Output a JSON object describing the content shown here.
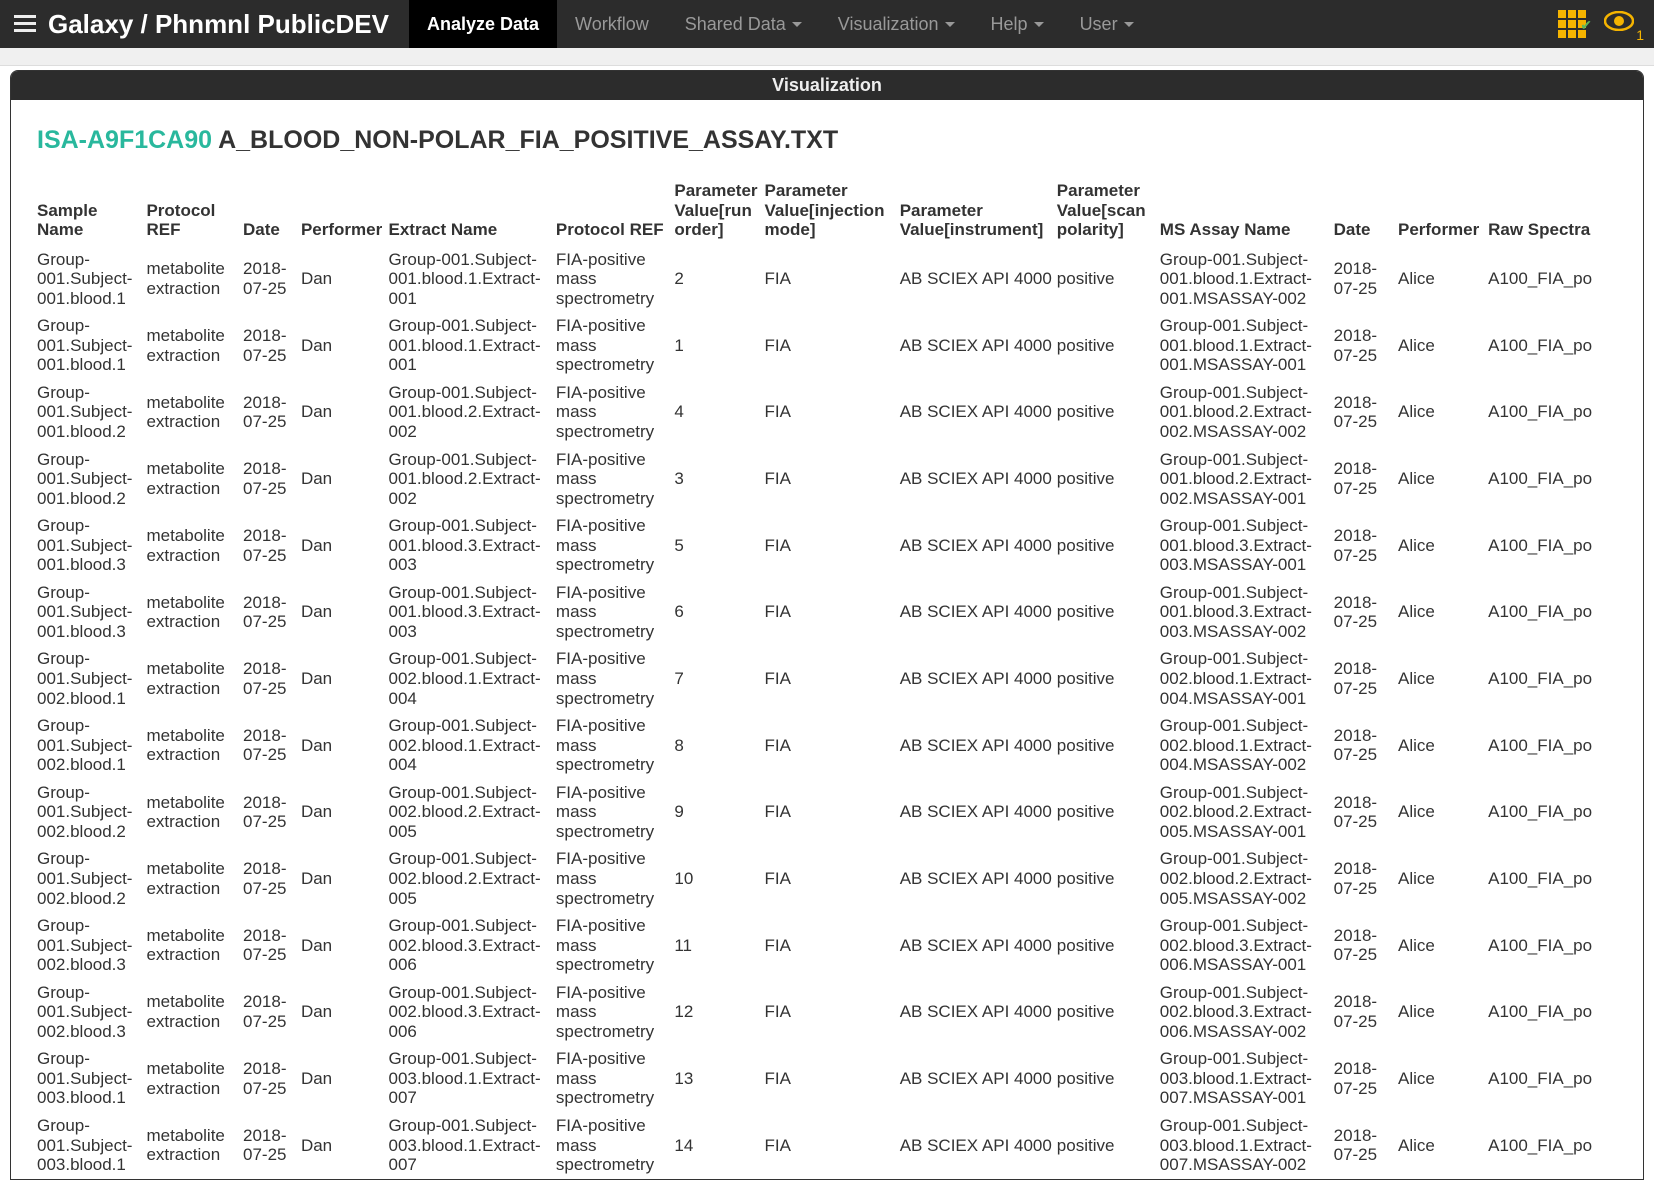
{
  "navbar": {
    "brand": "Galaxy / Phnmnl PublicDEV",
    "items": [
      {
        "label": "Analyze Data",
        "active": true,
        "dropdown": false
      },
      {
        "label": "Workflow",
        "active": false,
        "dropdown": false
      },
      {
        "label": "Shared Data",
        "active": false,
        "dropdown": true
      },
      {
        "label": "Visualization",
        "active": false,
        "dropdown": true
      },
      {
        "label": "Help",
        "active": false,
        "dropdown": true
      },
      {
        "label": "User",
        "active": false,
        "dropdown": true
      }
    ],
    "eye_badge": "1"
  },
  "panel": {
    "header": "Visualization",
    "isa_id": "ISA-A9F1CA90",
    "filename": "A_BLOOD_NON-POLAR_FIA_POSITIVE_ASSAY.TXT"
  },
  "table": {
    "headers": [
      "Sample Name",
      "Protocol REF",
      "Date",
      "Performer",
      "Extract Name",
      "Protocol REF",
      "Parameter Value[run order]",
      "Parameter Value[injection mode]",
      "Parameter Value[instrument]",
      "Parameter Value[scan polarity]",
      "MS Assay Name",
      "Date",
      "Performer",
      "Raw Spectra"
    ],
    "rows": [
      {
        "sample": "Group-001.Subject-001.blood.1",
        "proto1": "metabolite extraction",
        "date1": "2018-07-25",
        "perf1": "Dan",
        "extract": "Group-001.Subject-001.blood.1.Extract-001",
        "proto2": "FIA-positive mass spectrometry",
        "run": "2",
        "inj": "FIA",
        "instr": "AB SCIEX API 4000",
        "pol": "positive",
        "msassay": "Group-001.Subject-001.blood.1.Extract-001.MSASSAY-002",
        "date2": "2018-07-25",
        "perf2": "Alice",
        "raw": "A100_FIA_po"
      },
      {
        "sample": "Group-001.Subject-001.blood.1",
        "proto1": "metabolite extraction",
        "date1": "2018-07-25",
        "perf1": "Dan",
        "extract": "Group-001.Subject-001.blood.1.Extract-001",
        "proto2": "FIA-positive mass spectrometry",
        "run": "1",
        "inj": "FIA",
        "instr": "AB SCIEX API 4000",
        "pol": "positive",
        "msassay": "Group-001.Subject-001.blood.1.Extract-001.MSASSAY-001",
        "date2": "2018-07-25",
        "perf2": "Alice",
        "raw": "A100_FIA_po"
      },
      {
        "sample": "Group-001.Subject-001.blood.2",
        "proto1": "metabolite extraction",
        "date1": "2018-07-25",
        "perf1": "Dan",
        "extract": "Group-001.Subject-001.blood.2.Extract-002",
        "proto2": "FIA-positive mass spectrometry",
        "run": "4",
        "inj": "FIA",
        "instr": "AB SCIEX API 4000",
        "pol": "positive",
        "msassay": "Group-001.Subject-001.blood.2.Extract-002.MSASSAY-002",
        "date2": "2018-07-25",
        "perf2": "Alice",
        "raw": "A100_FIA_po"
      },
      {
        "sample": "Group-001.Subject-001.blood.2",
        "proto1": "metabolite extraction",
        "date1": "2018-07-25",
        "perf1": "Dan",
        "extract": "Group-001.Subject-001.blood.2.Extract-002",
        "proto2": "FIA-positive mass spectrometry",
        "run": "3",
        "inj": "FIA",
        "instr": "AB SCIEX API 4000",
        "pol": "positive",
        "msassay": "Group-001.Subject-001.blood.2.Extract-002.MSASSAY-001",
        "date2": "2018-07-25",
        "perf2": "Alice",
        "raw": "A100_FIA_po"
      },
      {
        "sample": "Group-001.Subject-001.blood.3",
        "proto1": "metabolite extraction",
        "date1": "2018-07-25",
        "perf1": "Dan",
        "extract": "Group-001.Subject-001.blood.3.Extract-003",
        "proto2": "FIA-positive mass spectrometry",
        "run": "5",
        "inj": "FIA",
        "instr": "AB SCIEX API 4000",
        "pol": "positive",
        "msassay": "Group-001.Subject-001.blood.3.Extract-003.MSASSAY-001",
        "date2": "2018-07-25",
        "perf2": "Alice",
        "raw": "A100_FIA_po"
      },
      {
        "sample": "Group-001.Subject-001.blood.3",
        "proto1": "metabolite extraction",
        "date1": "2018-07-25",
        "perf1": "Dan",
        "extract": "Group-001.Subject-001.blood.3.Extract-003",
        "proto2": "FIA-positive mass spectrometry",
        "run": "6",
        "inj": "FIA",
        "instr": "AB SCIEX API 4000",
        "pol": "positive",
        "msassay": "Group-001.Subject-001.blood.3.Extract-003.MSASSAY-002",
        "date2": "2018-07-25",
        "perf2": "Alice",
        "raw": "A100_FIA_po"
      },
      {
        "sample": "Group-001.Subject-002.blood.1",
        "proto1": "metabolite extraction",
        "date1": "2018-07-25",
        "perf1": "Dan",
        "extract": "Group-001.Subject-002.blood.1.Extract-004",
        "proto2": "FIA-positive mass spectrometry",
        "run": "7",
        "inj": "FIA",
        "instr": "AB SCIEX API 4000",
        "pol": "positive",
        "msassay": "Group-001.Subject-002.blood.1.Extract-004.MSASSAY-001",
        "date2": "2018-07-25",
        "perf2": "Alice",
        "raw": "A100_FIA_po"
      },
      {
        "sample": "Group-001.Subject-002.blood.1",
        "proto1": "metabolite extraction",
        "date1": "2018-07-25",
        "perf1": "Dan",
        "extract": "Group-001.Subject-002.blood.1.Extract-004",
        "proto2": "FIA-positive mass spectrometry",
        "run": "8",
        "inj": "FIA",
        "instr": "AB SCIEX API 4000",
        "pol": "positive",
        "msassay": "Group-001.Subject-002.blood.1.Extract-004.MSASSAY-002",
        "date2": "2018-07-25",
        "perf2": "Alice",
        "raw": "A100_FIA_po"
      },
      {
        "sample": "Group-001.Subject-002.blood.2",
        "proto1": "metabolite extraction",
        "date1": "2018-07-25",
        "perf1": "Dan",
        "extract": "Group-001.Subject-002.blood.2.Extract-005",
        "proto2": "FIA-positive mass spectrometry",
        "run": "9",
        "inj": "FIA",
        "instr": "AB SCIEX API 4000",
        "pol": "positive",
        "msassay": "Group-001.Subject-002.blood.2.Extract-005.MSASSAY-001",
        "date2": "2018-07-25",
        "perf2": "Alice",
        "raw": "A100_FIA_po"
      },
      {
        "sample": "Group-001.Subject-002.blood.2",
        "proto1": "metabolite extraction",
        "date1": "2018-07-25",
        "perf1": "Dan",
        "extract": "Group-001.Subject-002.blood.2.Extract-005",
        "proto2": "FIA-positive mass spectrometry",
        "run": "10",
        "inj": "FIA",
        "instr": "AB SCIEX API 4000",
        "pol": "positive",
        "msassay": "Group-001.Subject-002.blood.2.Extract-005.MSASSAY-002",
        "date2": "2018-07-25",
        "perf2": "Alice",
        "raw": "A100_FIA_po"
      },
      {
        "sample": "Group-001.Subject-002.blood.3",
        "proto1": "metabolite extraction",
        "date1": "2018-07-25",
        "perf1": "Dan",
        "extract": "Group-001.Subject-002.blood.3.Extract-006",
        "proto2": "FIA-positive mass spectrometry",
        "run": "11",
        "inj": "FIA",
        "instr": "AB SCIEX API 4000",
        "pol": "positive",
        "msassay": "Group-001.Subject-002.blood.3.Extract-006.MSASSAY-001",
        "date2": "2018-07-25",
        "perf2": "Alice",
        "raw": "A100_FIA_po"
      },
      {
        "sample": "Group-001.Subject-002.blood.3",
        "proto1": "metabolite extraction",
        "date1": "2018-07-25",
        "perf1": "Dan",
        "extract": "Group-001.Subject-002.blood.3.Extract-006",
        "proto2": "FIA-positive mass spectrometry",
        "run": "12",
        "inj": "FIA",
        "instr": "AB SCIEX API 4000",
        "pol": "positive",
        "msassay": "Group-001.Subject-002.blood.3.Extract-006.MSASSAY-002",
        "date2": "2018-07-25",
        "perf2": "Alice",
        "raw": "A100_FIA_po"
      },
      {
        "sample": "Group-001.Subject-003.blood.1",
        "proto1": "metabolite extraction",
        "date1": "2018-07-25",
        "perf1": "Dan",
        "extract": "Group-001.Subject-003.blood.1.Extract-007",
        "proto2": "FIA-positive mass spectrometry",
        "run": "13",
        "inj": "FIA",
        "instr": "AB SCIEX API 4000",
        "pol": "positive",
        "msassay": "Group-001.Subject-003.blood.1.Extract-007.MSASSAY-001",
        "date2": "2018-07-25",
        "perf2": "Alice",
        "raw": "A100_FIA_po"
      },
      {
        "sample": "Group-001.Subject-003.blood.1",
        "proto1": "metabolite extraction",
        "date1": "2018-07-25",
        "perf1": "Dan",
        "extract": "Group-001.Subject-003.blood.1.Extract-007",
        "proto2": "FIA-positive mass spectrometry",
        "run": "14",
        "inj": "FIA",
        "instr": "AB SCIEX API 4000",
        "pol": "positive",
        "msassay": "Group-001.Subject-003.blood.1.Extract-007.MSASSAY-002",
        "date2": "2018-07-25",
        "perf2": "Alice",
        "raw": "A100_FIA_po"
      }
    ]
  }
}
